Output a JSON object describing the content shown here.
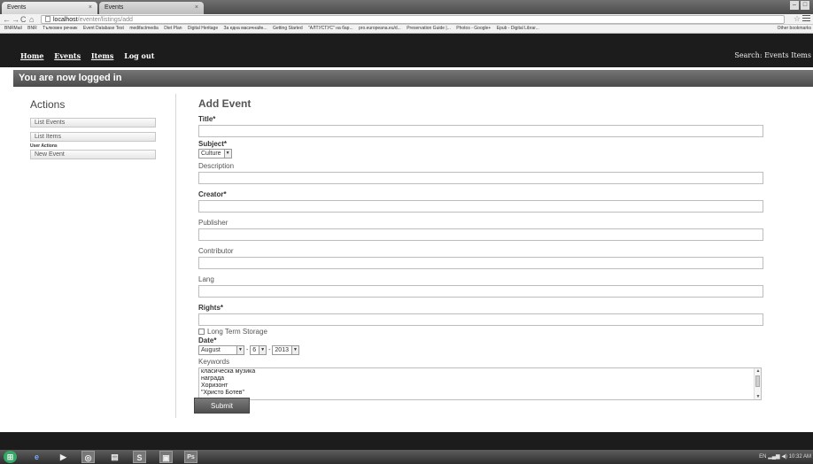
{
  "browser": {
    "tabs": [
      {
        "title": "Events"
      },
      {
        "title": "Events"
      }
    ],
    "url_host": "localhost",
    "url_path": "/eventer/listings/add",
    "bookmarks": [
      "BNRMail",
      "BNR",
      "Тълковен речник",
      "Event Database Test",
      "medifactmedia",
      "Diet Plan",
      "Digital Heritage",
      "За една масичнайн...",
      "Getting Started",
      "\"АЛТУСТУС\" на бар...",
      "pro.europeana.eu/d...",
      "Preservation Guide |...",
      "Photos - Google+",
      "Epub - Digital Librar..."
    ],
    "other_bookmarks": "Other bookmarks"
  },
  "nav": {
    "links": [
      "Home",
      "Events",
      "Items",
      "Log out"
    ],
    "search_label": "Search:",
    "search_options": [
      "Events",
      "Items"
    ]
  },
  "flash_message": "You are now logged in",
  "sidebar": {
    "title": "Actions",
    "list_events": "List Events",
    "list_items": "List Items",
    "user_actions_label": "User Actions",
    "new_event": "New Event"
  },
  "form": {
    "title": "Add Event",
    "labels": {
      "title": "Title*",
      "subject": "Subject*",
      "description": "Description",
      "creator": "Creator*",
      "publisher": "Publisher",
      "contributor": "Contributor",
      "lang": "Lang",
      "rights": "Rights*",
      "long_term_storage": "Long Term Storage",
      "date": "Date*",
      "keywords": "Keywords"
    },
    "subject_value": "Culture",
    "date": {
      "month": "August",
      "day": "6",
      "year": "2013"
    },
    "keywords_options": [
      "класическа музика",
      "награда",
      "Хоризонт",
      "\"Христо Ботев\""
    ],
    "submit_label": "Submit"
  },
  "taskbar": {
    "tray_lang": "EN",
    "clock": "10:32 AM"
  }
}
